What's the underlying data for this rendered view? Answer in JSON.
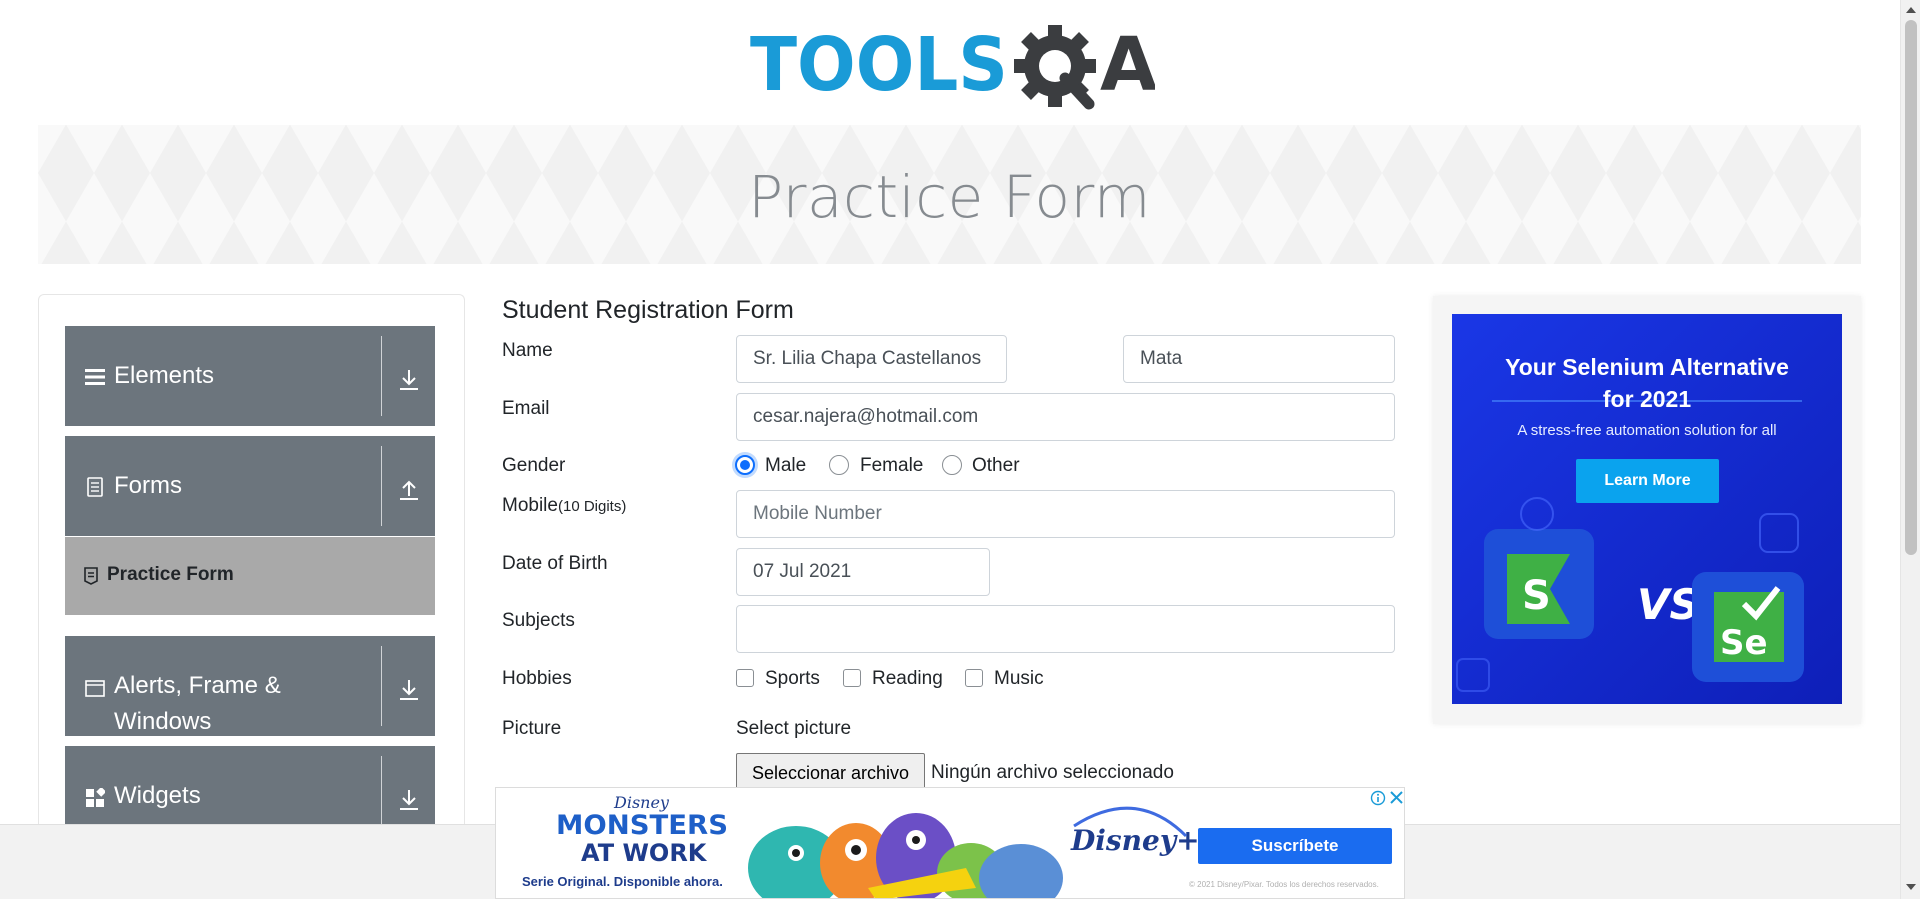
{
  "logo": {
    "text_left": "TOOLS",
    "text_right": "A",
    "colors": {
      "blue": "#1a9bd7",
      "gray": "#3b3d40"
    }
  },
  "banner": {
    "title": "Practice Form"
  },
  "sidebar": {
    "groups": [
      {
        "label": "Elements",
        "icon": "hamburger-icon",
        "arrow": "download-icon"
      },
      {
        "label": "Forms",
        "icon": "document-icon",
        "arrow": "upload-icon"
      },
      {
        "label_line1": "Alerts, Frame &",
        "label_line2": "Windows",
        "icon": "window-icon",
        "arrow": "download-icon"
      },
      {
        "label": "Widgets",
        "icon": "widgets-icon",
        "arrow": "download-icon"
      }
    ],
    "active_item": {
      "label": "Practice Form",
      "icon": "form-icon"
    }
  },
  "form": {
    "title": "Student Registration Form",
    "labels": {
      "name": "Name",
      "email": "Email",
      "gender": "Gender",
      "mobile": "Mobile",
      "mobile_hint": "(10 Digits)",
      "dob": "Date of Birth",
      "subjects": "Subjects",
      "hobbies": "Hobbies",
      "picture": "Picture"
    },
    "first_name": "Sr. Lilia Chapa Castellanos",
    "last_name": "Mata",
    "email": "cesar.najera@hotmail.com",
    "gender_options": [
      "Male",
      "Female",
      "Other"
    ],
    "gender_selected": "Male",
    "mobile_placeholder": "Mobile Number",
    "dob": "07 Jul 2021",
    "subjects": "",
    "hobbies": [
      "Sports",
      "Reading",
      "Music"
    ],
    "picture_label": "Select picture",
    "file_button": "Seleccionar archivo",
    "file_status": "Ningún archivo seleccionado"
  },
  "ad_right": {
    "headline_line1": "Your Selenium Alternative",
    "headline_line2": "for 2021",
    "subtext": "A stress-free automation solution for all",
    "button": "Learn More",
    "vs": "VS",
    "left_logo": "S",
    "right_logo": "Se",
    "colors": {
      "bg": "#1b2ee0",
      "button": "#0aa3ee",
      "green": "#3fb045"
    }
  },
  "ad_bottom": {
    "brand": "Disney",
    "title_line1": "MONSTERS",
    "title_line2": "AT WORK",
    "tagline": "Serie Original. Disponible ahora.",
    "service": "Disney+",
    "button": "Suscríbete",
    "fine_print": "© 2021 Disney/Pixar. Todos los derechos reservados.",
    "colors": {
      "navy": "#1e3c8c",
      "button": "#1a6cf0"
    }
  }
}
